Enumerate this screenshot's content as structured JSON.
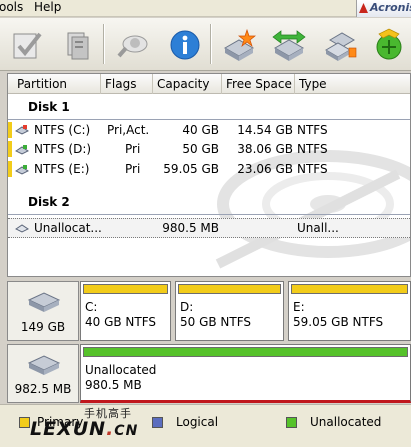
{
  "menu": {
    "tools_label": "ools",
    "help_label": "Help",
    "brand": "Acronis"
  },
  "toolbar": {
    "buttons": [
      {
        "name": "commit-changes"
      },
      {
        "name": "undo-operation"
      },
      {
        "name": "view-details"
      },
      {
        "name": "help-info"
      },
      {
        "name": "create-partition"
      },
      {
        "name": "resize-partition"
      },
      {
        "name": "copy-partition"
      },
      {
        "name": "recovery-wizard"
      }
    ]
  },
  "columns": {
    "partition": "Partition",
    "flags": "Flags",
    "capacity": "Capacity",
    "free_space": "Free Space",
    "type": "Type"
  },
  "disks": [
    {
      "label": "Disk 1",
      "rows": [
        {
          "partition": "NTFS (C:)",
          "flags": "Pri,Act.",
          "capacity": "40 GB",
          "free": "14.54 GB",
          "type": "NTFS"
        },
        {
          "partition": "NTFS (D:)",
          "flags": "Pri",
          "capacity": "50 GB",
          "free": "38.06 GB",
          "type": "NTFS"
        },
        {
          "partition": "NTFS (E:)",
          "flags": "Pri",
          "capacity": "59.05 GB",
          "free": "23.06 GB",
          "type": "NTFS"
        }
      ]
    },
    {
      "label": "Disk 2",
      "rows": [
        {
          "partition": "Unallocat...",
          "flags": "",
          "capacity": "980.5 MB",
          "free": "",
          "type": "Unall..."
        }
      ]
    }
  ],
  "map": {
    "disk1": {
      "size": "149 GB",
      "parts": [
        {
          "name": "C:",
          "info": "40 GB  NTFS"
        },
        {
          "name": "D:",
          "info": "50 GB  NTFS"
        },
        {
          "name": "E:",
          "info": "59.05 GB  NTFS"
        }
      ]
    },
    "disk2": {
      "size": "982.5 MB",
      "parts": [
        {
          "name": "Unallocated",
          "info": "980.5 MB"
        }
      ]
    }
  },
  "legend": {
    "primary": "Primary",
    "logical": "Logical",
    "unallocated": "Unallocated"
  },
  "credit": {
    "cn": "手机高手",
    "en": "LEXUN",
    "dot": ".",
    "suffix": "CN"
  },
  "colors": {
    "primary": "#f2cc1a",
    "logical": "#5b6dbf",
    "unallocated": "#56c22a",
    "disk_line": "#9aa2b4"
  }
}
